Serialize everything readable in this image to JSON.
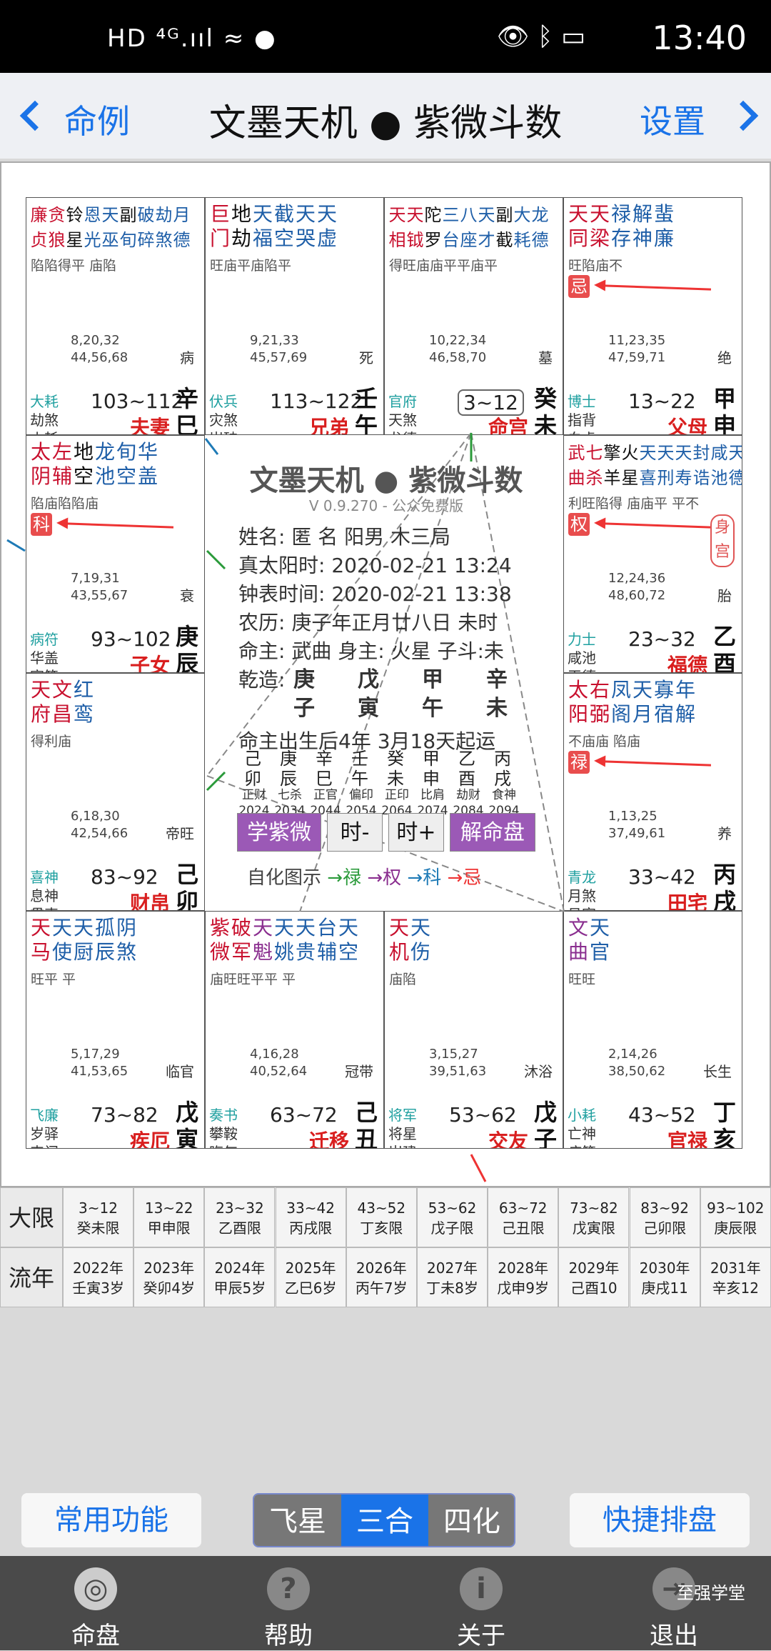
{
  "status": {
    "left": "HD ⁴ᴳ.ııl ≈ ●",
    "right": "👁 ᛒ ▭",
    "time": "13:40"
  },
  "nav": {
    "back": "命例",
    "title": "文墨天机 ● 紫微斗数",
    "settings": "设置"
  },
  "cells": [
    {
      "id": "si",
      "stars": [
        [
          "廉",
          "r"
        ],
        [
          "贪",
          "r"
        ],
        [
          "铃",
          "k"
        ],
        [
          "恩",
          "b"
        ],
        [
          "天",
          "b"
        ],
        [
          "副",
          "k"
        ],
        [
          "破",
          "b"
        ],
        [
          "劫",
          "b"
        ],
        [
          "月",
          "b"
        ]
      ],
      "stars2": [
        [
          "贞",
          "r"
        ],
        [
          "狼",
          "r"
        ],
        [
          "星",
          "k"
        ],
        [
          "光",
          "b"
        ],
        [
          "巫",
          "b"
        ],
        [
          "旬",
          "b"
        ],
        [
          "碎",
          "b"
        ],
        [
          "煞",
          "b"
        ],
        [
          "德",
          "b"
        ]
      ],
      "bright": "陷陷得平  庙陷",
      "ages1": "8,20,32",
      "ages2": "44,56,68",
      "cs": "病",
      "g1": "大耗",
      "g2": "劫煞",
      "g3": "小耗",
      "range": "103~112",
      "gz1": "辛",
      "gz2": "巳",
      "palace": "夫妻"
    },
    {
      "id": "wu",
      "stars": [
        [
          "巨",
          "r"
        ],
        [
          "地",
          "k"
        ],
        [
          "天",
          "b"
        ],
        [
          "截",
          "b"
        ],
        [
          "天",
          "b"
        ],
        [
          "天",
          "b"
        ]
      ],
      "stars2": [
        [
          "门",
          "r"
        ],
        [
          "劫",
          "k"
        ],
        [
          "福",
          "b"
        ],
        [
          "空",
          "b"
        ],
        [
          "哭",
          "b"
        ],
        [
          "虚",
          "b"
        ]
      ],
      "bright": "旺庙平庙陷平",
      "ages1": "9,21,33",
      "ages2": "45,57,69",
      "cs": "死",
      "g1": "伏兵",
      "g2": "灾煞",
      "g3": "岁破",
      "range": "113~122",
      "gz1": "壬",
      "gz2": "午",
      "palace": "兄弟"
    },
    {
      "id": "wei",
      "stars": [
        [
          "天",
          "r"
        ],
        [
          "天",
          "r"
        ],
        [
          "陀",
          "k"
        ],
        [
          "三",
          "b"
        ],
        [
          "八",
          "b"
        ],
        [
          "天",
          "b"
        ],
        [
          "副",
          "k"
        ],
        [
          "大",
          "b"
        ],
        [
          "龙",
          "b"
        ]
      ],
      "stars2": [
        [
          "相",
          "r"
        ],
        [
          "钺",
          "r"
        ],
        [
          "罗",
          "k"
        ],
        [
          "台",
          "b"
        ],
        [
          "座",
          "b"
        ],
        [
          "才",
          "b"
        ],
        [
          "截",
          "k"
        ],
        [
          "耗",
          "b"
        ],
        [
          "德",
          "b"
        ]
      ],
      "bright": "得旺庙庙平平庙平",
      "ages1": "10,22,34",
      "ages2": "46,58,70",
      "cs": "墓",
      "g1": "官府",
      "g2": "天煞",
      "g3": "龙德",
      "range": "3~12",
      "gz1": "癸",
      "gz2": "未",
      "palace": "命宫"
    },
    {
      "id": "shen",
      "stars": [
        [
          "天",
          "r"
        ],
        [
          "天",
          "r"
        ],
        [
          "禄",
          "b"
        ],
        [
          "解",
          "b"
        ],
        [
          "蜚",
          "b"
        ]
      ],
      "stars2": [
        [
          "同",
          "r"
        ],
        [
          "梁",
          "r"
        ],
        [
          "存",
          "b"
        ],
        [
          "神",
          "b"
        ],
        [
          "廉",
          "b"
        ]
      ],
      "bright": "旺陷庙不",
      "ages1": "11,23,35",
      "ages2": "47,59,71",
      "cs": "绝",
      "g1": "博士",
      "g2": "指背",
      "g3": "白虎",
      "range": "13~22",
      "gz1": "甲",
      "gz2": "申",
      "palace": "父母",
      "badge": "忌"
    },
    {
      "id": "chen",
      "stars": [
        [
          "太",
          "r"
        ],
        [
          "左",
          "r"
        ],
        [
          "地",
          "k"
        ],
        [
          "龙",
          "b"
        ],
        [
          "旬",
          "b"
        ],
        [
          "华",
          "b"
        ]
      ],
      "stars2": [
        [
          "阴",
          "r"
        ],
        [
          "辅",
          "r"
        ],
        [
          "空",
          "k"
        ],
        [
          "池",
          "b"
        ],
        [
          "空",
          "b"
        ],
        [
          "盖",
          "b"
        ]
      ],
      "bright": "陷庙陷陷庙",
      "ages1": "7,19,31",
      "ages2": "43,55,67",
      "cs": "衰",
      "g1": "病符",
      "g2": "华盖",
      "g3": "官符",
      "range": "93~102",
      "gz1": "庚",
      "gz2": "辰",
      "palace": "子女",
      "badge": "科"
    },
    {
      "id": "you",
      "stars": [
        [
          "武",
          "r"
        ],
        [
          "七",
          "r"
        ],
        [
          "擎",
          "k"
        ],
        [
          "火",
          "k"
        ],
        [
          "天",
          "b"
        ],
        [
          "天",
          "b"
        ],
        [
          "天",
          "b"
        ],
        [
          "封",
          "b"
        ],
        [
          "咸",
          "b"
        ],
        [
          "天",
          "b"
        ]
      ],
      "stars2": [
        [
          "曲",
          "r"
        ],
        [
          "杀",
          "r"
        ],
        [
          "羊",
          "k"
        ],
        [
          "星",
          "k"
        ],
        [
          "喜",
          "b"
        ],
        [
          "刑",
          "b"
        ],
        [
          "寿",
          "b"
        ],
        [
          "诰",
          "b"
        ],
        [
          "池",
          "b"
        ],
        [
          "德",
          "b"
        ]
      ],
      "bright": "利旺陷得 庙庙平  平不",
      "ages1": "12,24,36",
      "ages2": "48,60,72",
      "cs": "胎",
      "g1": "力士",
      "g2": "咸池",
      "g3": "天德",
      "range": "23~32",
      "gz1": "乙",
      "gz2": "酉",
      "palace": "福德",
      "badge": "权",
      "shen": "身宫"
    },
    {
      "id": "mao",
      "stars": [
        [
          "天",
          "r"
        ],
        [
          "文",
          "r"
        ],
        [
          "红",
          "b"
        ]
      ],
      "stars2": [
        [
          "府",
          "r"
        ],
        [
          "昌",
          "r"
        ],
        [
          "鸾",
          "b"
        ]
      ],
      "bright": "得利庙",
      "ages1": "6,18,30",
      "ages2": "42,54,66",
      "cs": "帝旺",
      "g1": "喜神",
      "g2": "息神",
      "g3": "贯索",
      "range": "83~92",
      "gz1": "己",
      "gz2": "卯",
      "palace": "财帛"
    },
    {
      "id": "xu",
      "stars": [
        [
          "太",
          "r"
        ],
        [
          "右",
          "r"
        ],
        [
          "凤",
          "b"
        ],
        [
          "天",
          "b"
        ],
        [
          "寡",
          "b"
        ],
        [
          "年",
          "b"
        ]
      ],
      "stars2": [
        [
          "阳",
          "r"
        ],
        [
          "弼",
          "r"
        ],
        [
          "阁",
          "b"
        ],
        [
          "月",
          "b"
        ],
        [
          "宿",
          "b"
        ],
        [
          "解",
          "b"
        ]
      ],
      "bright": "不庙庙  陷庙",
      "ages1": "1,13,25",
      "ages2": "37,49,61",
      "cs": "养",
      "g1": "青龙",
      "g2": "月煞",
      "g3": "吊客",
      "range": "33~42",
      "gz1": "丙",
      "gz2": "戌",
      "palace": "田宅",
      "badge": "禄"
    },
    {
      "id": "yin",
      "stars": [
        [
          "天",
          "r"
        ],
        [
          "天",
          "b"
        ],
        [
          "天",
          "b"
        ],
        [
          "孤",
          "b"
        ],
        [
          "阴",
          "b"
        ]
      ],
      "stars2": [
        [
          "马",
          "r"
        ],
        [
          "使",
          "b"
        ],
        [
          "厨",
          "b"
        ],
        [
          "辰",
          "b"
        ],
        [
          "煞",
          "b"
        ]
      ],
      "bright": "旺平  平",
      "ages1": "5,17,29",
      "ages2": "41,53,65",
      "cs": "临官",
      "g1": "飞廉",
      "g2": "岁驿",
      "g3": "丧门",
      "range": "73~82",
      "gz1": "戊",
      "gz2": "寅",
      "palace": "疾厄"
    },
    {
      "id": "chou",
      "stars": [
        [
          "紫",
          "r"
        ],
        [
          "破",
          "r"
        ],
        [
          "天",
          "p"
        ],
        [
          "天",
          "b"
        ],
        [
          "天",
          "b"
        ],
        [
          "台",
          "b"
        ],
        [
          "天",
          "b"
        ]
      ],
      "stars2": [
        [
          "微",
          "r"
        ],
        [
          "军",
          "r"
        ],
        [
          "魁",
          "p"
        ],
        [
          "姚",
          "b"
        ],
        [
          "贵",
          "b"
        ],
        [
          "辅",
          "b"
        ],
        [
          "空",
          "b"
        ]
      ],
      "bright": "庙旺旺平平  平",
      "ages1": "4,16,28",
      "ages2": "40,52,64",
      "cs": "冠带",
      "g1": "奏书",
      "g2": "攀鞍",
      "g3": "晦气",
      "range": "63~72",
      "gz1": "己",
      "gz2": "丑",
      "palace": "迁移"
    },
    {
      "id": "zi",
      "stars": [
        [
          "天",
          "r"
        ],
        [
          "天",
          "b"
        ]
      ],
      "stars2": [
        [
          "机",
          "r"
        ],
        [
          "伤",
          "b"
        ]
      ],
      "bright": "庙陷",
      "ages1": "3,15,27",
      "ages2": "39,51,63",
      "cs": "沐浴",
      "g1": "将军",
      "g2": "将星",
      "g3": "岁建",
      "range": "53~62",
      "gz1": "戊",
      "gz2": "子",
      "palace": "交友"
    },
    {
      "id": "hai",
      "stars": [
        [
          "文",
          "p"
        ],
        [
          "天",
          "b"
        ]
      ],
      "stars2": [
        [
          "曲",
          "p"
        ],
        [
          "官",
          "b"
        ]
      ],
      "bright": "旺旺",
      "ages1": "2,14,26",
      "ages2": "38,50,62",
      "cs": "长生",
      "g1": "小耗",
      "g2": "亡神",
      "g3": "病符",
      "range": "43~52",
      "gz1": "丁",
      "gz2": "亥",
      "palace": "官禄"
    }
  ],
  "center": {
    "title": "文墨天机 ● 紫微斗数",
    "version": "V 0.9.270 - 公众免费版",
    "name": "姓名: 匿 名      阳男  木三局",
    "solar": "真太阳时: 2020-02-21   13:24",
    "clock": "钟表时间: 2020-02-21   13:38",
    "lunar": "农历: 庚子年正月廿八日 未时",
    "ming": "命主: 武曲 身主: 火星 子斗:未",
    "qz_label": "乾造:",
    "p_top": [
      "庚",
      "戊",
      "甲",
      "辛"
    ],
    "p_bot": [
      "子",
      "寅",
      "午",
      "未"
    ],
    "yun": "命主出生后4年  3月18天起运",
    "dy_top": [
      "己",
      "庚",
      "辛",
      "壬",
      "癸",
      "甲",
      "乙",
      "丙"
    ],
    "dy_bot": [
      "卯",
      "辰",
      "巳",
      "午",
      "未",
      "申",
      "酉",
      "戌"
    ],
    "dy_god": [
      "正财",
      "七杀",
      "正官",
      "偏印",
      "正印",
      "比肩",
      "劫财",
      "食神"
    ],
    "dy_year": [
      "2024",
      "2034",
      "2044",
      "2054",
      "2064",
      "2074",
      "2084",
      "2094"
    ],
    "btn_learn": "学紫微",
    "btn_prev": "时-",
    "btn_next": "时+",
    "btn_read": "解命盘",
    "legend_label": "自化图示",
    "lg1": "→禄",
    "lg2": "→权",
    "lg3": "→科",
    "lg4": "→忌"
  },
  "table": {
    "h1": "大限",
    "h2": "流年",
    "daxian": [
      [
        "3~12",
        "癸未限"
      ],
      [
        "13~22",
        "甲申限"
      ],
      [
        "23~32",
        "乙酉限"
      ],
      [
        "33~42",
        "丙戌限"
      ],
      [
        "43~52",
        "丁亥限"
      ],
      [
        "53~62",
        "戊子限"
      ],
      [
        "63~72",
        "己丑限"
      ],
      [
        "73~82",
        "戊寅限"
      ],
      [
        "83~92",
        "己卯限"
      ],
      [
        "93~102",
        "庚辰限"
      ]
    ],
    "liunian": [
      [
        "2022年",
        "壬寅3岁"
      ],
      [
        "2023年",
        "癸卯4岁"
      ],
      [
        "2024年",
        "甲辰5岁"
      ],
      [
        "2025年",
        "乙巳6岁"
      ],
      [
        "2026年",
        "丙午7岁"
      ],
      [
        "2027年",
        "丁未8岁"
      ],
      [
        "2028年",
        "戊申9岁"
      ],
      [
        "2029年",
        "己酉10"
      ],
      [
        "2030年",
        "庚戌11"
      ],
      [
        "2031年",
        "辛亥12"
      ]
    ]
  },
  "toolbar": {
    "common": "常用功能",
    "seg": [
      "飞星",
      "三合",
      "四化"
    ],
    "quick": "快捷排盘"
  },
  "tabs": [
    {
      "label": "命盘",
      "icon": "◎"
    },
    {
      "label": "帮助",
      "icon": "?"
    },
    {
      "label": "关于",
      "icon": "i"
    },
    {
      "label": "退出",
      "icon": "⇥"
    }
  ],
  "watermark": "至强学堂"
}
